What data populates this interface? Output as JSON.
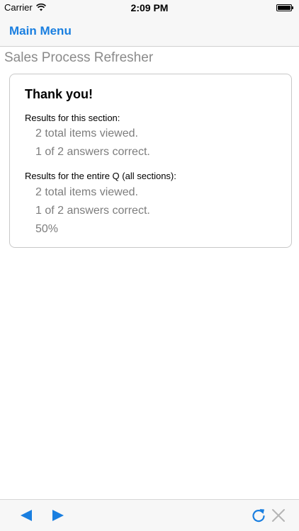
{
  "status_bar": {
    "carrier": "Carrier",
    "time": "2:09 PM",
    "wifi_icon": "wifi-icon",
    "battery_icon": "battery-icon",
    "battery_level": 1.0
  },
  "nav": {
    "back_label": "Main Menu"
  },
  "page": {
    "title": "Sales Process Refresher"
  },
  "card": {
    "heading": "Thank you!",
    "section": {
      "label": "Results for this section:",
      "items_viewed": "2 total items viewed.",
      "answers_correct": "1 of 2 answers correct."
    },
    "overall": {
      "label": "Results for the entire Q (all sections):",
      "items_viewed": "2 total items viewed.",
      "answers_correct": "1 of 2 answers correct.",
      "percent": "50%"
    }
  },
  "toolbar": {
    "previous_icon": "arrow-left-icon",
    "next_icon": "arrow-right-icon",
    "refresh_icon": "refresh-icon",
    "close_icon": "close-icon"
  },
  "colors": {
    "accent": "#1a7fe0",
    "muted_text": "#7d7d7d",
    "disabled": "#b5b5b5"
  }
}
